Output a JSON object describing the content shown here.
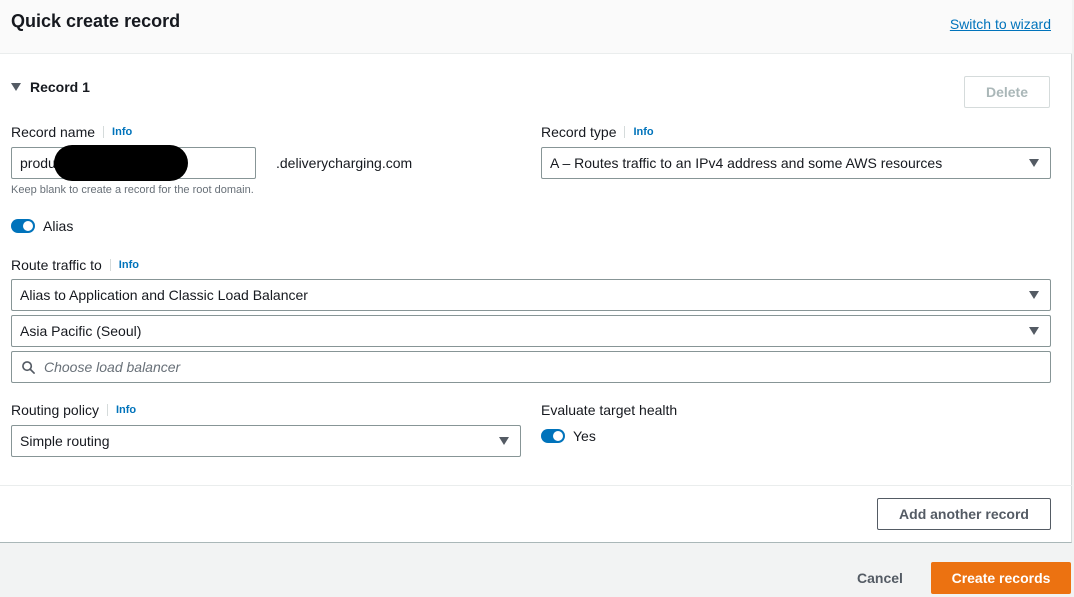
{
  "header": {
    "title": "Quick create record",
    "switch_link": "Switch to wizard"
  },
  "record": {
    "section_label": "Record 1",
    "delete_label": "Delete",
    "record_name": {
      "label": "Record name",
      "info": "Info",
      "value": "produ",
      "domain_suffix": ".deliverycharging.com",
      "hint": "Keep blank to create a record for the root domain."
    },
    "record_type": {
      "label": "Record type",
      "info": "Info",
      "value": "A – Routes traffic to an IPv4 address and some AWS resources"
    },
    "alias": {
      "label": "Alias",
      "enabled": true
    },
    "route_traffic": {
      "label": "Route traffic to",
      "info": "Info",
      "endpoint": "Alias to Application and Classic Load Balancer",
      "region": "Asia Pacific (Seoul)",
      "load_balancer_placeholder": "Choose load balancer"
    },
    "routing_policy": {
      "label": "Routing policy",
      "info": "Info",
      "value": "Simple routing"
    },
    "evaluate_health": {
      "label": "Evaluate target health",
      "value_label": "Yes",
      "enabled": true
    },
    "add_another_label": "Add another record"
  },
  "footer": {
    "cancel_label": "Cancel",
    "create_label": "Create records"
  },
  "colors": {
    "primary": "#ec7211",
    "link": "#0073bb",
    "toggle_on": "#0073bb"
  }
}
